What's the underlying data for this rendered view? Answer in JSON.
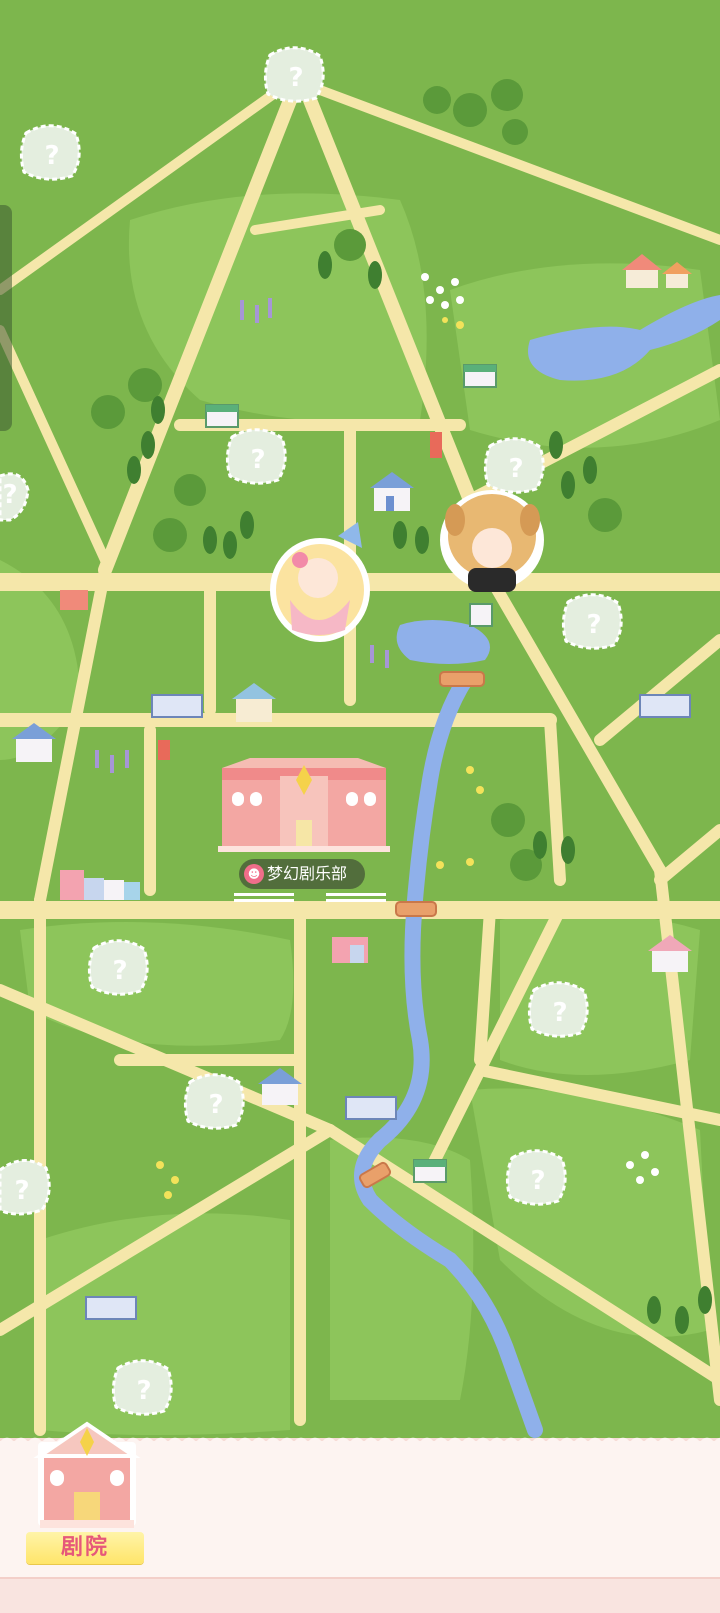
{
  "map": {
    "locked_marker": "?",
    "colors": {
      "grass": "#7fb84e",
      "grass_light": "#8cc65a",
      "road": "#f5e7aa",
      "river": "#8fb0ea",
      "locked_bubble": "#e4eedf"
    },
    "club_building": {
      "label": "梦幻剧乐部",
      "icon": "mask-icon"
    }
  },
  "bottom_bar": {
    "theater_button": {
      "label": "剧院",
      "icon": "theater-icon"
    }
  }
}
